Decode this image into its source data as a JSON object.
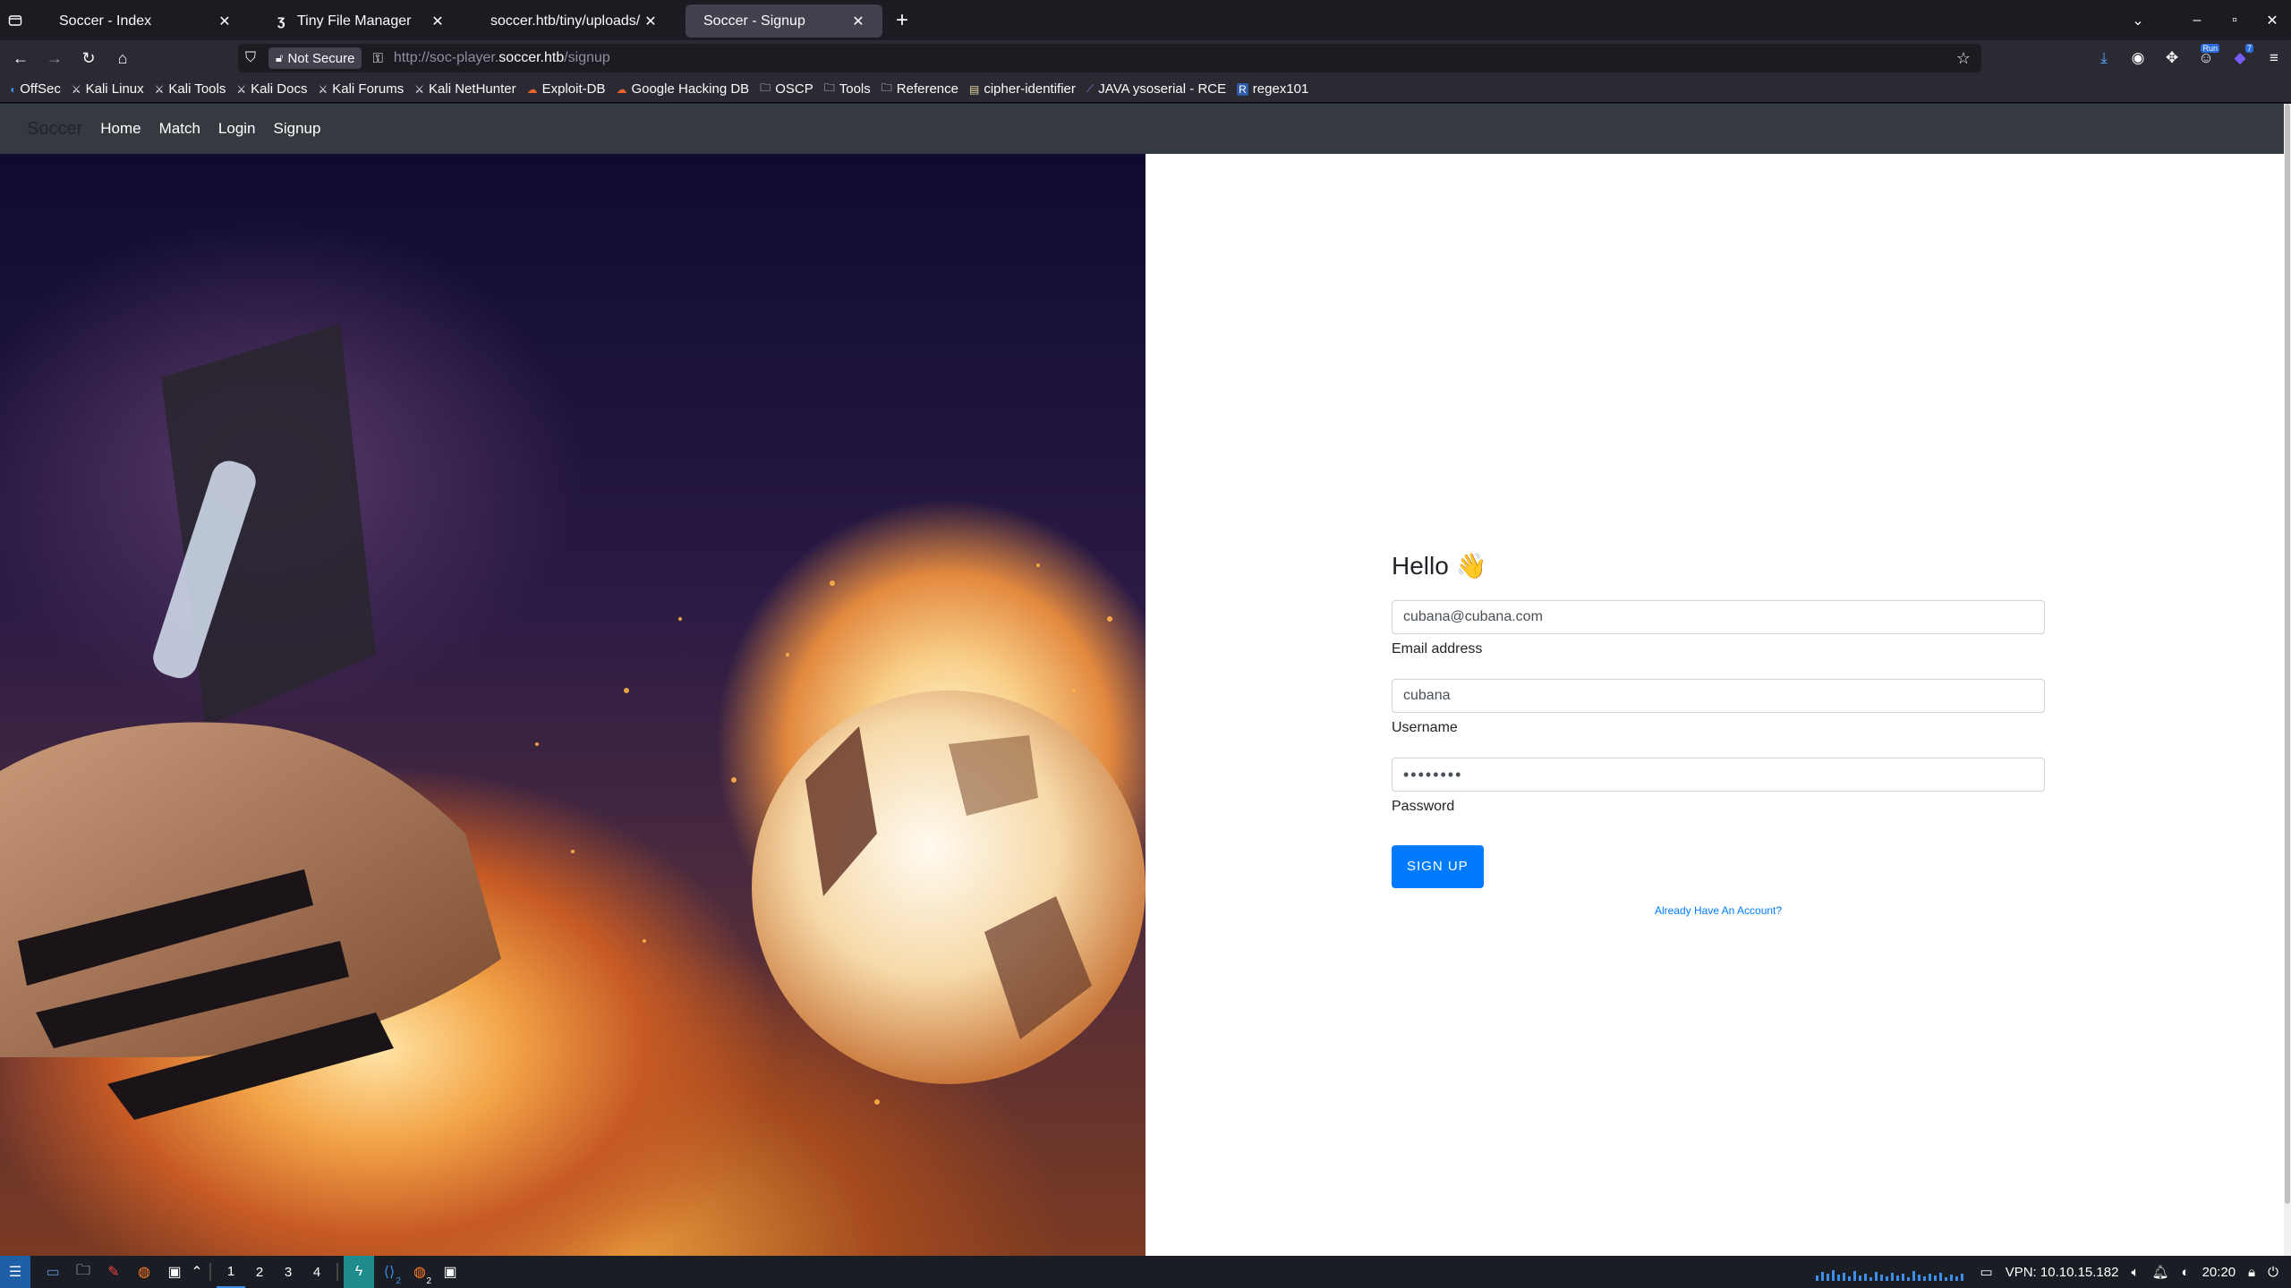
{
  "browser": {
    "tabs": [
      {
        "title": "Soccer - Index",
        "active": false
      },
      {
        "title": "Tiny File Manager",
        "active": false,
        "favicon": "tiny-file-manager-icon"
      },
      {
        "title": "soccer.htb/tiny/uploads/shell",
        "active": false
      },
      {
        "title": "Soccer - Signup",
        "active": true
      }
    ],
    "security_label": "Not Secure",
    "url_prefix": "http://soc-player.",
    "url_host": "soccer.htb",
    "url_path": "/signup",
    "extension_badges": [
      "Run",
      "7"
    ]
  },
  "bookmarks": [
    {
      "label": "OffSec",
      "icon": "dragon-icon"
    },
    {
      "label": "Kali Linux",
      "icon": "kali-icon"
    },
    {
      "label": "Kali Tools",
      "icon": "kali-icon"
    },
    {
      "label": "Kali Docs",
      "icon": "kali-icon"
    },
    {
      "label": "Kali Forums",
      "icon": "kali-icon"
    },
    {
      "label": "Kali NetHunter",
      "icon": "kali-icon"
    },
    {
      "label": "Exploit-DB",
      "icon": "exploit-db-icon"
    },
    {
      "label": "Google Hacking DB",
      "icon": "exploit-db-icon"
    },
    {
      "label": "OSCP",
      "icon": "folder-icon"
    },
    {
      "label": "Tools",
      "icon": "folder-icon"
    },
    {
      "label": "Reference",
      "icon": "folder-icon"
    },
    {
      "label": "cipher-identifier",
      "icon": "dcode-icon"
    },
    {
      "label": "JAVA ysoserial - RCE",
      "icon": "bookmark-icon"
    },
    {
      "label": "regex101",
      "icon": "regex-icon"
    }
  ],
  "site": {
    "brand": "Soccer",
    "nav": [
      "Home",
      "Match",
      "Login",
      "Signup"
    ]
  },
  "form": {
    "heading": "Hello 👋",
    "email_value": "cubana@cubana.com",
    "email_label": "Email address",
    "username_value": "cubana",
    "username_label": "Username",
    "password_value": "••••••••",
    "password_label": "Password",
    "submit_label": "SIGN UP",
    "account_link": "Already Have An Account?"
  },
  "taskbar": {
    "workspaces": [
      "1",
      "2",
      "3",
      "4"
    ],
    "active_workspace": "1",
    "app_badges": [
      "2",
      "2"
    ],
    "vpn": "VPN: 10.10.15.182",
    "time": "20:20"
  }
}
